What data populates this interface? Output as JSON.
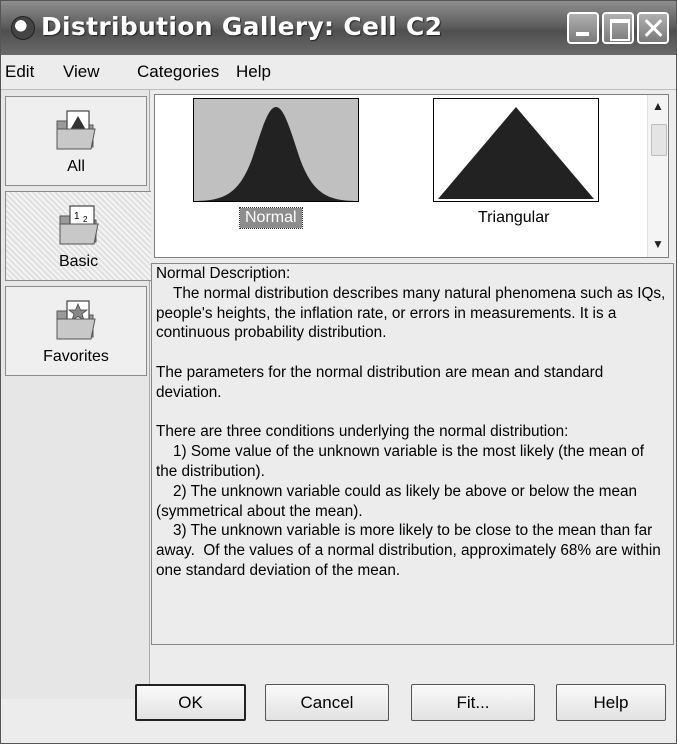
{
  "window": {
    "title": "Distribution Gallery: Cell C2"
  },
  "menu": [
    "Edit",
    "View",
    "Categories",
    "Help"
  ],
  "categories": [
    {
      "label": "All",
      "icon": "folder-all-icon",
      "selected": false
    },
    {
      "label": "Basic",
      "icon": "folder-basic-icon",
      "selected": true
    },
    {
      "label": "Favorites",
      "icon": "folder-favorites-icon",
      "selected": false
    }
  ],
  "gallery": {
    "items": [
      {
        "label": "Normal",
        "icon": "normal-curve-icon",
        "selected": true
      },
      {
        "label": "Triangular",
        "icon": "triangle-distribution-icon",
        "selected": false
      }
    ]
  },
  "description": {
    "text": "Normal Description:\n    The normal distribution describes many natural phenomena such as IQs, people's heights, the inflation rate, or errors in measurements. It is a continuous probability distribution.\n\nThe parameters for the normal distribution are mean and standard deviation.\n\nThere are three conditions underlying the normal distribution:\n    1) Some value of the unknown variable is the most likely (the mean of the distribution).\n    2) The unknown variable could as likely be above or below the mean (symmetrical about the mean).\n    3) The unknown variable is more likely to be close to the mean than far away.  Of the values of a normal distribution, approximately 68% are within one standard deviation of the mean."
  },
  "buttons": {
    "ok": "OK",
    "cancel": "Cancel",
    "fit": "Fit...",
    "help": "Help"
  },
  "colors": {
    "titlebar": "#5f5f5f",
    "selection": "#8d8d8d",
    "thumbnail_fill": "#222222",
    "normal_bg": "#c0c0c0"
  }
}
